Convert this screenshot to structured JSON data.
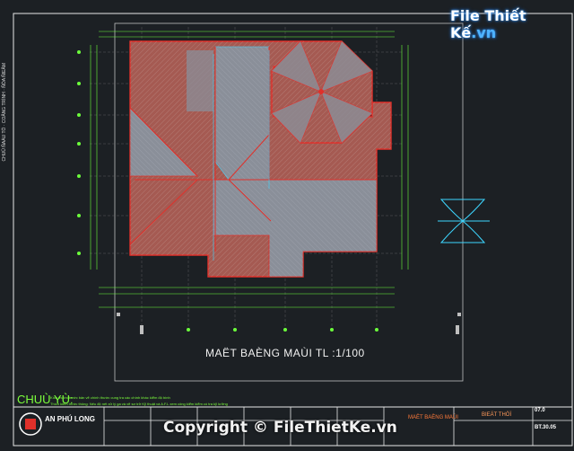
{
  "watermark": {
    "brand_prefix": "File Thiết Kế",
    "brand_suffix": ".vn"
  },
  "copyright": "Copyright © FileThietKe.vn",
  "plan": {
    "title": "MAËT BAÈNG MAÙI   TL :1/100"
  },
  "notes": {
    "heading": "CHUÙ YÙ:",
    "line1": "Kích thước trước bản vẽ chính thước cung tra các chính khác kiểm độ bình",
    "line2": "Thích kiểm trước thông: Nếu độ nét xử lý ga và vẽ sơ trở Kỹ thuật và A.F.L xem công kiểm kiểm có tra kỹ lưỡng"
  },
  "title_block": {
    "company": "AN PHÚ LONG",
    "sheet_name": "MAËT BAÈNG MAÙI",
    "kt_label": "BIEÄT THÖÏ",
    "drawing_code": "BT.30.05",
    "date": "07.0"
  },
  "left_strip": "CHUÛ ÑAÀU TÖ · COÂNG TRÌNH · ÑÒA ÑIEÅM",
  "colors": {
    "background": "#1c2024",
    "roof_fill": "#a55a52",
    "roof_outline": "#e0302a",
    "gray_panel": "#8a8f99",
    "frame": "#e8e8e8",
    "dimension_green": "#6cff3c",
    "cyan": "#3dd6ff"
  },
  "icons": [
    "octagon-dome-icon",
    "hourglass-symbol-icon"
  ]
}
